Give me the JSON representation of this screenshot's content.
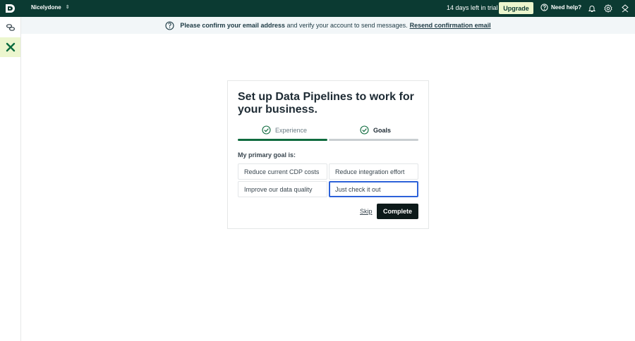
{
  "topbar": {
    "workspace_name": "Nicelydone",
    "trial_text": "14 days left in trial",
    "upgrade_label": "Upgrade",
    "help_label": "Need help?"
  },
  "banner": {
    "bold_text": "Please confirm your email address",
    "text": "and verify your account to send messages.",
    "link_text": "Resend confirmation email"
  },
  "onboarding": {
    "title": "Set up Data Pipelines to work for your business.",
    "steps": [
      {
        "label": "Experience",
        "state": "completed"
      },
      {
        "label": "Goals",
        "state": "active"
      }
    ],
    "goal_label": "My primary goal is:",
    "options": [
      {
        "label": "Reduce current CDP costs",
        "selected": false
      },
      {
        "label": "Reduce integration effort",
        "selected": false
      },
      {
        "label": "Improve our data quality",
        "selected": false
      },
      {
        "label": "Just check it out",
        "selected": true
      }
    ],
    "skip_label": "Skip",
    "complete_label": "Complete"
  },
  "icons": [
    "logo-icon",
    "chevron-updown-icon",
    "help-circle-icon",
    "bell-icon",
    "settings-icon",
    "user-icon",
    "connections-icon",
    "pipelines-icon",
    "info-icon",
    "check-circle-icon"
  ],
  "colors": {
    "topbar_bg": "#0b3a32",
    "accent_lime": "#ecf6ce",
    "progress_green": "#0f6b3e",
    "selected_blue": "#2d62d9"
  }
}
